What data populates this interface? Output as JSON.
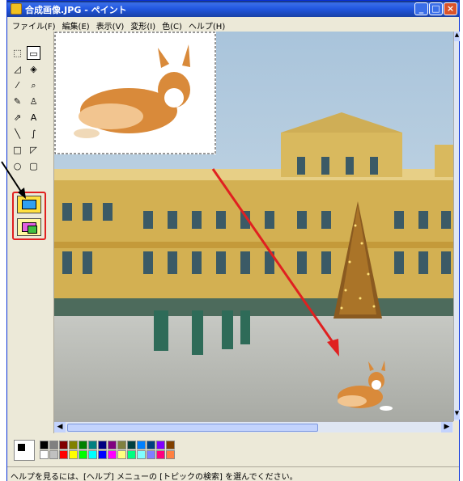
{
  "window": {
    "title": "合成画像.JPG - ペイント",
    "min_label": "_",
    "max_label": "□",
    "close_label": "×"
  },
  "menu": [
    "ファイル(F)",
    "編集(E)",
    "表示(V)",
    "変形(I)",
    "色(C)",
    "ヘルプ(H)"
  ],
  "tools": [
    {
      "name": "free-select-tool",
      "glyph": "⬚"
    },
    {
      "name": "rect-select-tool",
      "glyph": "▭",
      "selected": true
    },
    {
      "name": "eraser-tool",
      "glyph": "◿"
    },
    {
      "name": "fill-tool",
      "glyph": "◈"
    },
    {
      "name": "color-picker-tool",
      "glyph": "⁄"
    },
    {
      "name": "magnifier-tool",
      "glyph": "⌕"
    },
    {
      "name": "pencil-tool",
      "glyph": "✎"
    },
    {
      "name": "brush-tool",
      "glyph": "♙"
    },
    {
      "name": "airbrush-tool",
      "glyph": "⇗"
    },
    {
      "name": "text-tool",
      "glyph": "A"
    },
    {
      "name": "line-tool",
      "glyph": "╲"
    },
    {
      "name": "curve-tool",
      "glyph": "∫"
    },
    {
      "name": "rectangle-tool",
      "glyph": "□"
    },
    {
      "name": "polygon-tool",
      "glyph": "◸"
    },
    {
      "name": "ellipse-tool",
      "glyph": "○"
    },
    {
      "name": "rounded-rect-tool",
      "glyph": "▢"
    }
  ],
  "palette": [
    "#000000",
    "#808080",
    "#800000",
    "#808000",
    "#008000",
    "#008080",
    "#000080",
    "#800080",
    "#808040",
    "#004040",
    "#0080ff",
    "#004080",
    "#8000ff",
    "#804000",
    "#ffffff",
    "#c0c0c0",
    "#ff0000",
    "#ffff00",
    "#00ff00",
    "#00ffff",
    "#0000ff",
    "#ff00ff",
    "#ffff80",
    "#00ff80",
    "#80ffff",
    "#8080ff",
    "#ff0080",
    "#ff8040"
  ],
  "status": {
    "text": "ヘルプを見るには、[ヘルプ] メニューの [トピックの検索] を選んでください。"
  },
  "colors": {
    "annotation_red": "#e02020",
    "title_blue": "#2056e0"
  }
}
